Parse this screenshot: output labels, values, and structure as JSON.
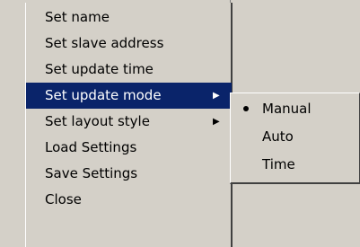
{
  "menu": {
    "items": [
      {
        "label": "Set name",
        "has_submenu": false,
        "highlighted": false
      },
      {
        "label": "Set slave address",
        "has_submenu": false,
        "highlighted": false
      },
      {
        "label": "Set update time",
        "has_submenu": false,
        "highlighted": false
      },
      {
        "label": "Set update mode",
        "has_submenu": true,
        "highlighted": true
      },
      {
        "label": "Set layout style",
        "has_submenu": true,
        "highlighted": false
      },
      {
        "label": "Load Settings",
        "has_submenu": false,
        "highlighted": false
      },
      {
        "label": "Save Settings",
        "has_submenu": false,
        "highlighted": false
      },
      {
        "label": "Close",
        "has_submenu": false,
        "highlighted": false
      }
    ],
    "highlight_color": "#0a246a",
    "background_color": "#d4d0c8"
  },
  "submenu": {
    "items": [
      {
        "label": "Manual",
        "selected": true
      },
      {
        "label": "Auto",
        "selected": false
      },
      {
        "label": "Time",
        "selected": false
      }
    ]
  }
}
